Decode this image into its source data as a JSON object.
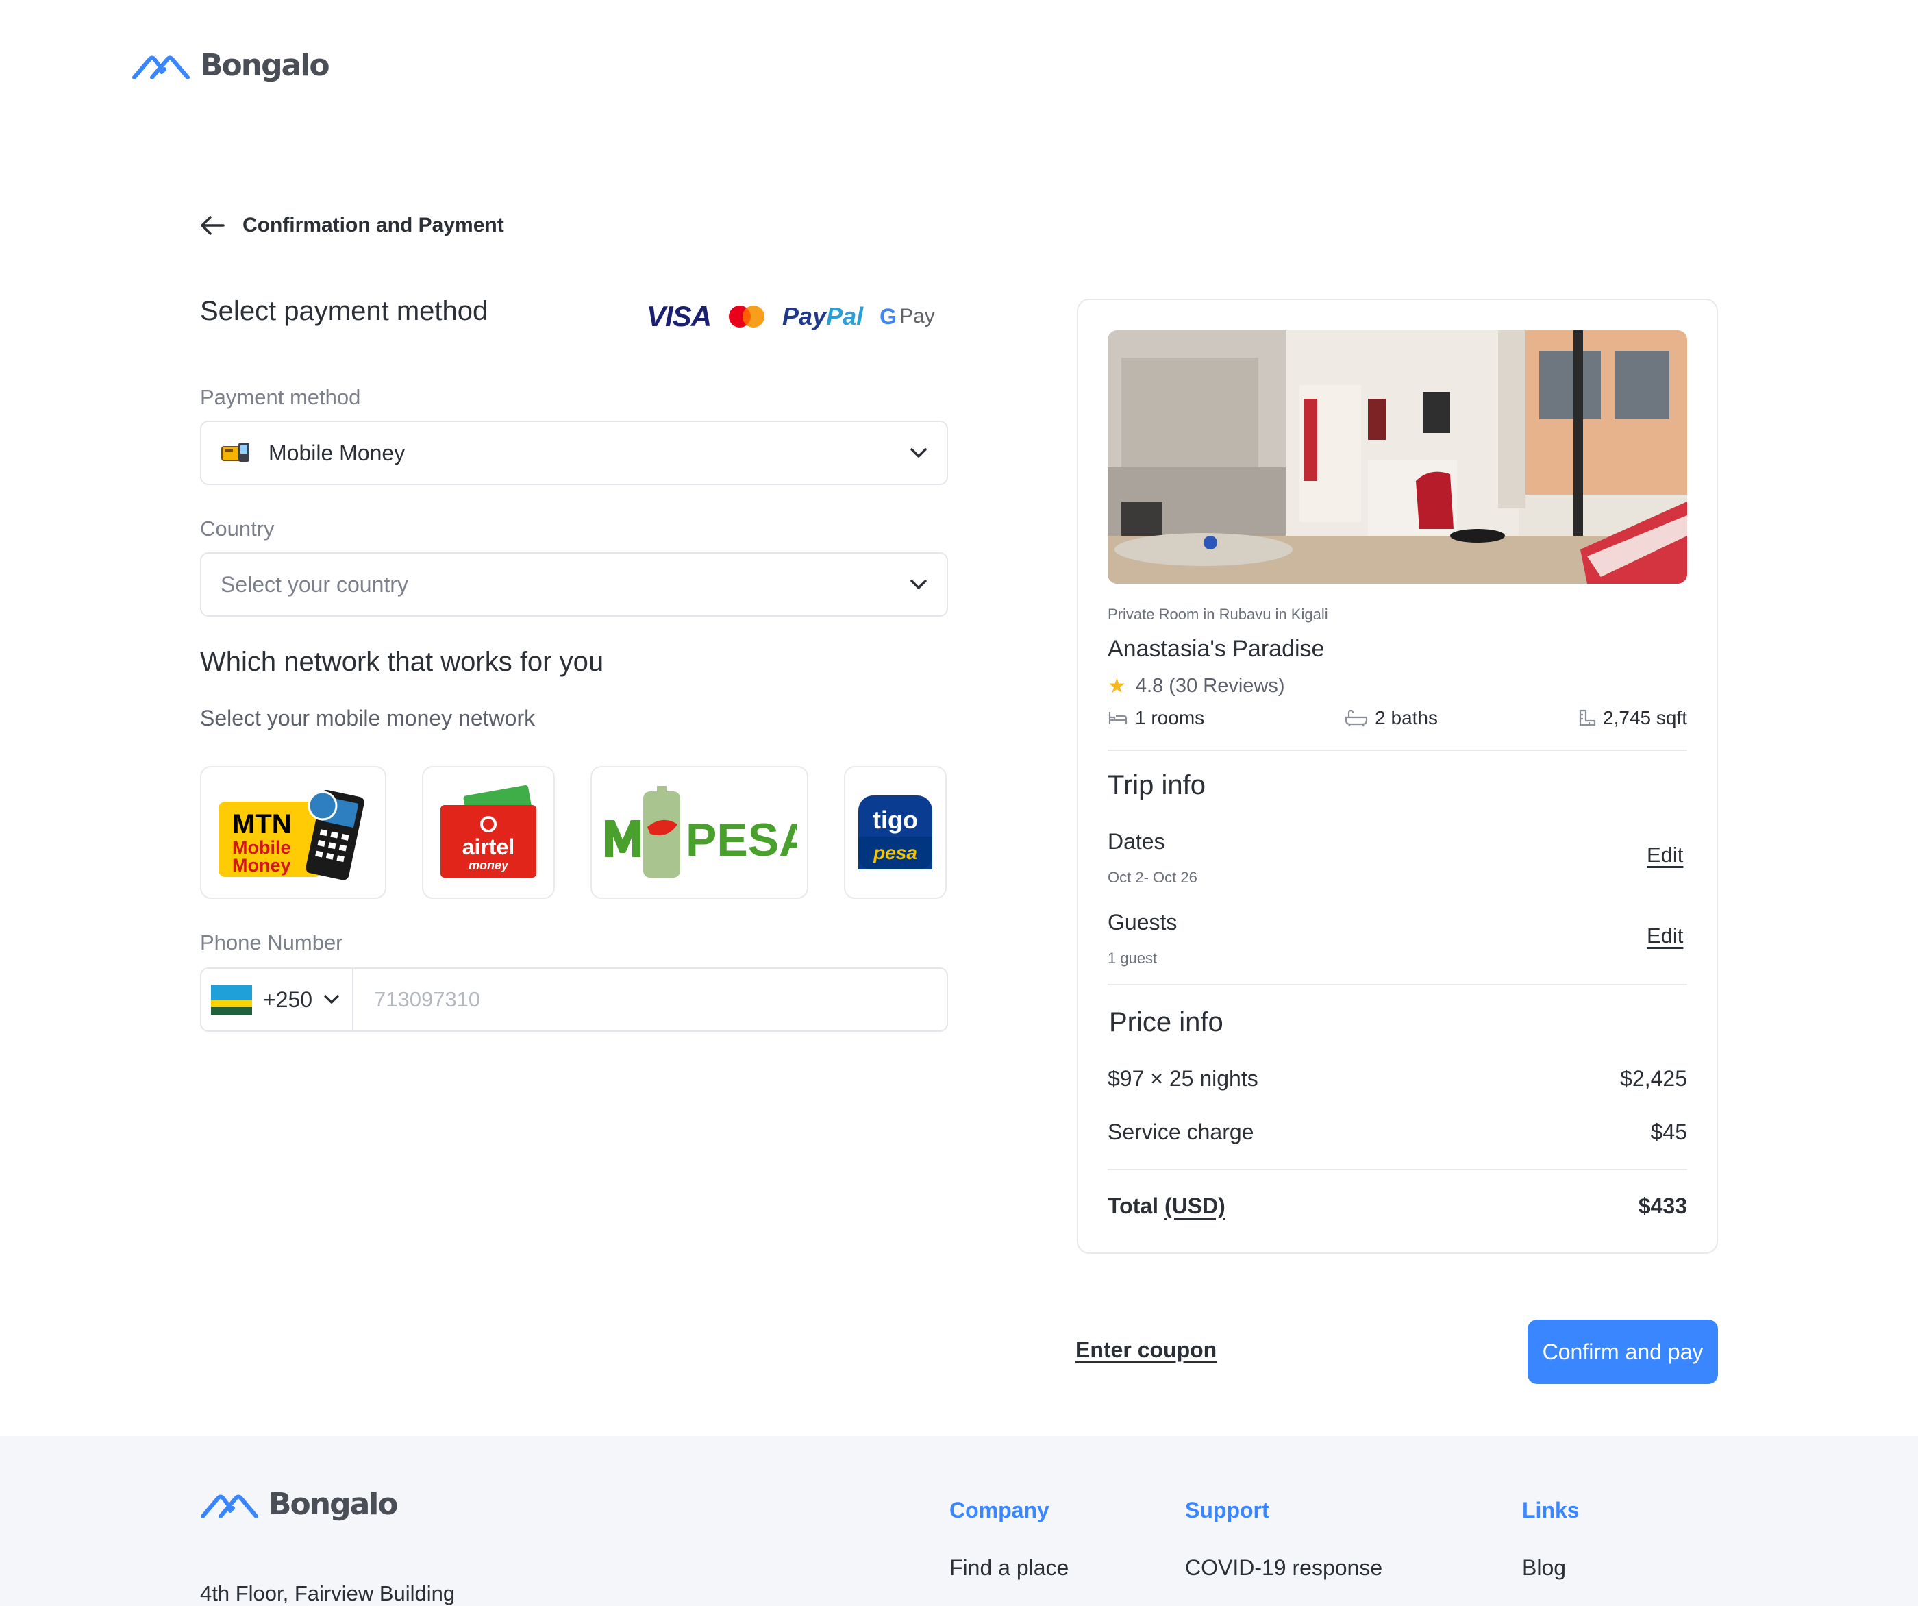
{
  "brand": {
    "name": "Bongalo",
    "accent": "#3a86ff"
  },
  "page": {
    "title": "Confirmation and Payment"
  },
  "payment": {
    "heading": "Select payment method",
    "brands": [
      "VISA",
      "Mastercard",
      "PayPal",
      "G Pay"
    ],
    "method_label": "Payment method",
    "method_value": "Mobile Money",
    "country_label": "Country",
    "country_placeholder": "Select your country"
  },
  "network": {
    "heading": "Which network that works for you",
    "subheading": "Select your mobile money network",
    "options": [
      {
        "name": "MTN Mobile Money",
        "line1": "MTN",
        "line2": "Mobile",
        "line3": "Money"
      },
      {
        "name": "airtel money",
        "line1": "airtel",
        "line2": "money"
      },
      {
        "name": "M-PESA",
        "text": "PESA"
      },
      {
        "name": "tigo pesa",
        "line1": "tigo",
        "line2": "pesa"
      }
    ]
  },
  "phone": {
    "label": "Phone Number",
    "country_code": "+250",
    "placeholder": "713097310"
  },
  "listing": {
    "type_location": "Private Room in Rubavu in Kigali",
    "name": "Anastasia's Paradise",
    "rating": "4.8 (30 Reviews)",
    "rooms": "1 rooms",
    "baths": "2 baths",
    "area": "2,745 sqft"
  },
  "trip": {
    "heading": "Trip info",
    "dates_label": "Dates",
    "dates_value": "Oct 2- Oct 26",
    "guests_label": "Guests",
    "guests_value": "1 guest",
    "edit_label": "Edit"
  },
  "price": {
    "heading": "Price info",
    "nightly_label": "$97 × 25 nights",
    "nightly_value": "$2,425",
    "service_label": "Service charge",
    "service_value": "$45",
    "total_label": "Total",
    "total_currency": "(USD)",
    "total_value": "$433"
  },
  "actions": {
    "coupon": "Enter coupon",
    "confirm": "Confirm and pay"
  },
  "footer": {
    "brand": "Bongalo",
    "address_line": "4th Floor, Fairview Building",
    "columns": [
      {
        "heading": "Company",
        "first_link": "Find a place"
      },
      {
        "heading": "Support",
        "first_link": "COVID-19 response"
      },
      {
        "heading": "Links",
        "first_link": "Blog"
      }
    ]
  }
}
